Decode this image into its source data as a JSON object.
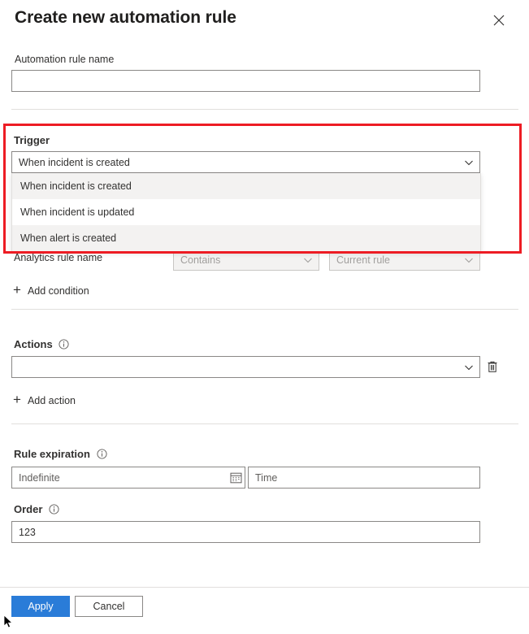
{
  "header": {
    "title": "Create new automation rule",
    "close_label": "Close"
  },
  "name_section": {
    "label": "Automation rule name",
    "value": "",
    "placeholder": ""
  },
  "trigger_section": {
    "label": "Trigger",
    "selected": "When incident is created",
    "options": [
      "When incident is created",
      "When incident is updated",
      "When alert is created"
    ],
    "dropdown_open": true,
    "highlight_color": "#ed1c24"
  },
  "conditions_section": {
    "rows": [
      {
        "property": "Analytics rule name",
        "operator": "Contains",
        "value": "Current rule"
      }
    ],
    "add_condition_label": "Add condition",
    "add_icon": "plus-icon"
  },
  "actions_section": {
    "label": "Actions",
    "info_icon": "info-icon",
    "action_value": "",
    "delete_icon": "trash-icon",
    "add_action_label": "Add action",
    "add_icon": "plus-icon"
  },
  "expiration_section": {
    "label": "Rule expiration",
    "info_icon": "info-icon",
    "date_placeholder": "Indefinite",
    "date_value": "",
    "date_icon": "calendar-icon",
    "time_placeholder": "Time",
    "time_value": ""
  },
  "order_section": {
    "label": "Order",
    "info_icon": "info-icon",
    "value": "123",
    "placeholder": ""
  },
  "footer": {
    "apply_label": "Apply",
    "cancel_label": "Cancel",
    "primary_color": "#2a7cd8"
  }
}
